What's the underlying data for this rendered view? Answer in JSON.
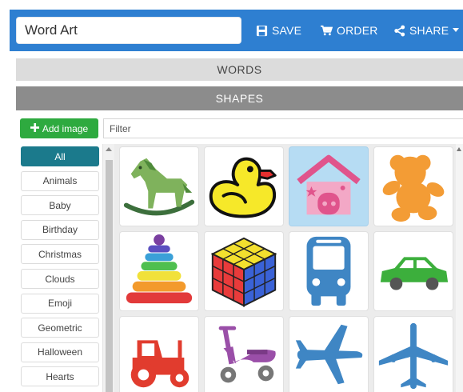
{
  "header": {
    "title_value": "Word Art",
    "save_label": "SAVE",
    "order_label": "ORDER",
    "share_label": "SHARE"
  },
  "panels": {
    "words_label": "WORDS",
    "shapes_label": "SHAPES"
  },
  "toolbar": {
    "add_image_label": "Add image",
    "filter_placeholder": "Filter"
  },
  "categories": [
    {
      "label": "All",
      "active": true
    },
    {
      "label": "Animals"
    },
    {
      "label": "Baby"
    },
    {
      "label": "Birthday"
    },
    {
      "label": "Christmas"
    },
    {
      "label": "Clouds"
    },
    {
      "label": "Emoji"
    },
    {
      "label": "Geometric"
    },
    {
      "label": "Halloween"
    },
    {
      "label": "Hearts"
    }
  ],
  "shapes": [
    {
      "name": "rocking-horse",
      "selected": false
    },
    {
      "name": "rubber-duck",
      "selected": false
    },
    {
      "name": "house",
      "selected": true
    },
    {
      "name": "teddy-bear",
      "selected": false
    },
    {
      "name": "stacking-rings",
      "selected": false
    },
    {
      "name": "rubiks-cube",
      "selected": false
    },
    {
      "name": "bus",
      "selected": false
    },
    {
      "name": "car",
      "selected": false
    },
    {
      "name": "tractor",
      "selected": false
    },
    {
      "name": "scooter",
      "selected": false
    },
    {
      "name": "airplane",
      "selected": false
    },
    {
      "name": "airplane-top",
      "selected": false
    }
  ],
  "colors": {
    "header_blue": "#2e7fd1",
    "category_active": "#1b7a8c",
    "add_button": "#2eaa3f",
    "selected_tile": "#b6dcf3"
  }
}
